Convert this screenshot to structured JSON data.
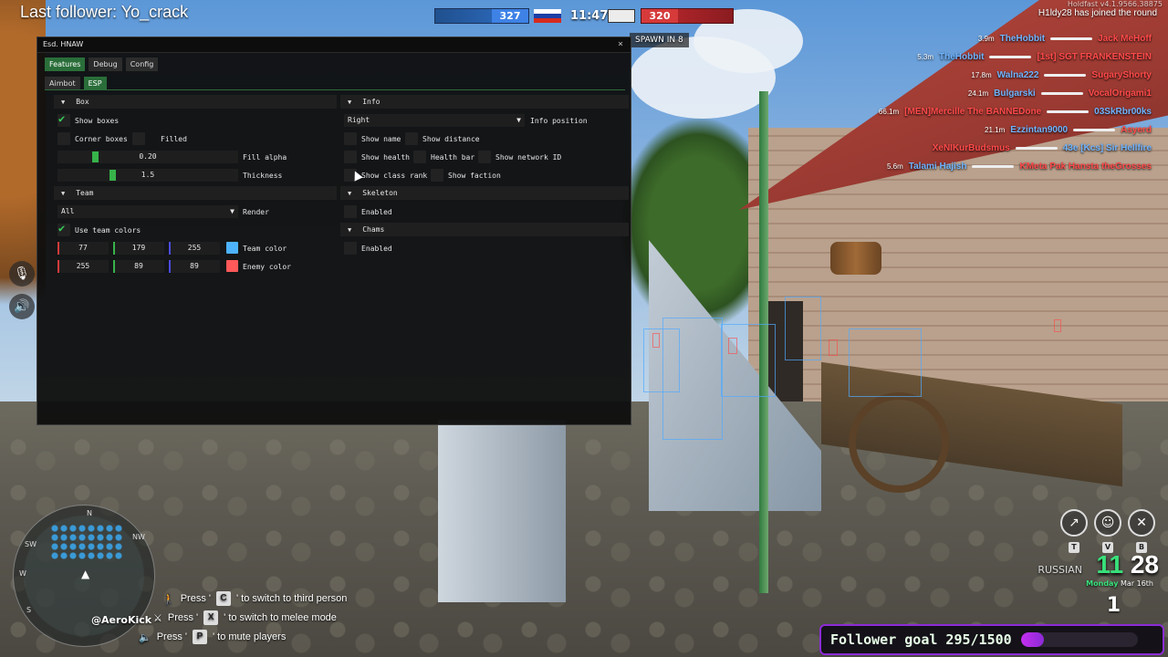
{
  "hud": {
    "follower_title": "Last follower: Yo_crack",
    "score_blue": "327",
    "score_red": "320",
    "clock": "11:47",
    "spawn_text": "SPAWN IN 8",
    "joined_text": "H1ldy28 has joined the round",
    "version_text": "Holdfast v4.1.9566.38875",
    "streamer_name": "@AeroKick",
    "colors": {
      "blue": "#3e82e6",
      "red": "#d63a3a",
      "accent_green": "#37d35c"
    }
  },
  "killfeed": [
    {
      "distance": "3.9m",
      "killer": "TheHobbit",
      "victim": "Jack MeHoff"
    },
    {
      "distance": "5.3m",
      "killer": "TheHobbit",
      "victim": "[1st] SGT FRANKENSTEIN"
    },
    {
      "distance": "17.8m",
      "killer": "Walna222",
      "victim": "SugaryShorty"
    },
    {
      "distance": "24.1m",
      "killer": "Bulgarski",
      "victim": "VocalOrigami1"
    },
    {
      "distance": "66.1m",
      "killer": "[MEN]Mercille The BANNEDone",
      "victim": "03SkRbr00ks"
    },
    {
      "distance": "21.1m",
      "killer": "Ezzintan9000",
      "victim": "Asyerd"
    },
    {
      "distance": "",
      "killer": "XeNIKurBudsmus",
      "victim": "43e [Kcs] Sir Hellfire"
    },
    {
      "distance": "5.6m",
      "killer": "Talami Hajish",
      "victim": "KMeta Pak Hansta theGrosses"
    }
  ],
  "hints": [
    {
      "prefix": "Press '",
      "key": "C",
      "suffix": "' to switch to third person"
    },
    {
      "prefix": "Press '",
      "key": "X",
      "suffix": "' to switch to melee mode"
    },
    {
      "prefix": "Press '",
      "key": "P",
      "suffix": "' to mute players"
    }
  ],
  "minimap": {
    "dirs": [
      "SW",
      "W",
      "NW",
      "S",
      "N"
    ]
  },
  "action_keys": [
    "T",
    "V",
    "B"
  ],
  "game_clock": {
    "hours": "11",
    "minutes": "28",
    "day": "Monday",
    "date": "Mar 16th"
  },
  "faction_label": "RUSSIAN",
  "ammo": "1",
  "goal": {
    "label": "Follower goal 295/1500",
    "current": 295,
    "target": 1500
  },
  "menu": {
    "title": "Esd. HNAW",
    "close_glyph": "×",
    "tabs": [
      "Features",
      "Debug",
      "Config"
    ],
    "active_tab": "Features",
    "subtabs": [
      "Aimbot",
      "ESP"
    ],
    "active_subtab": "ESP",
    "box": {
      "header": "Box",
      "show_boxes": {
        "label": "Show boxes",
        "checked": true
      },
      "corner_boxes": {
        "label": "Corner boxes",
        "checked": false
      },
      "filled": {
        "label": "Filled",
        "checked": false
      },
      "fill_alpha": {
        "label": "Fill alpha",
        "value": "0.20",
        "fraction": 0.2
      },
      "thickness": {
        "label": "Thickness",
        "value": "1.5",
        "fraction": 0.3
      }
    },
    "team": {
      "header": "Team",
      "render_label": "Render",
      "render_value": "All",
      "use_team_colors": {
        "label": "Use team colors",
        "checked": true
      },
      "team_color": {
        "label": "Team color",
        "r": "77",
        "g": "179",
        "b": "255",
        "hex": "#4db3ff"
      },
      "enemy_color": {
        "label": "Enemy color",
        "r": "255",
        "g": "89",
        "b": "89",
        "hex": "#ff5959"
      }
    },
    "info": {
      "header": "Info",
      "position_label": "Info position",
      "position_value": "Right",
      "show_name": "Show name",
      "show_distance": "Show distance",
      "show_health": "Show health",
      "health_bar": "Health bar",
      "show_network_id": "Show network ID",
      "show_class_rank": "Show class rank",
      "show_faction": "Show faction"
    },
    "skeleton": {
      "header": "Skeleton",
      "enabled": "Enabled"
    },
    "chams": {
      "header": "Chams",
      "enabled": "Enabled"
    }
  }
}
